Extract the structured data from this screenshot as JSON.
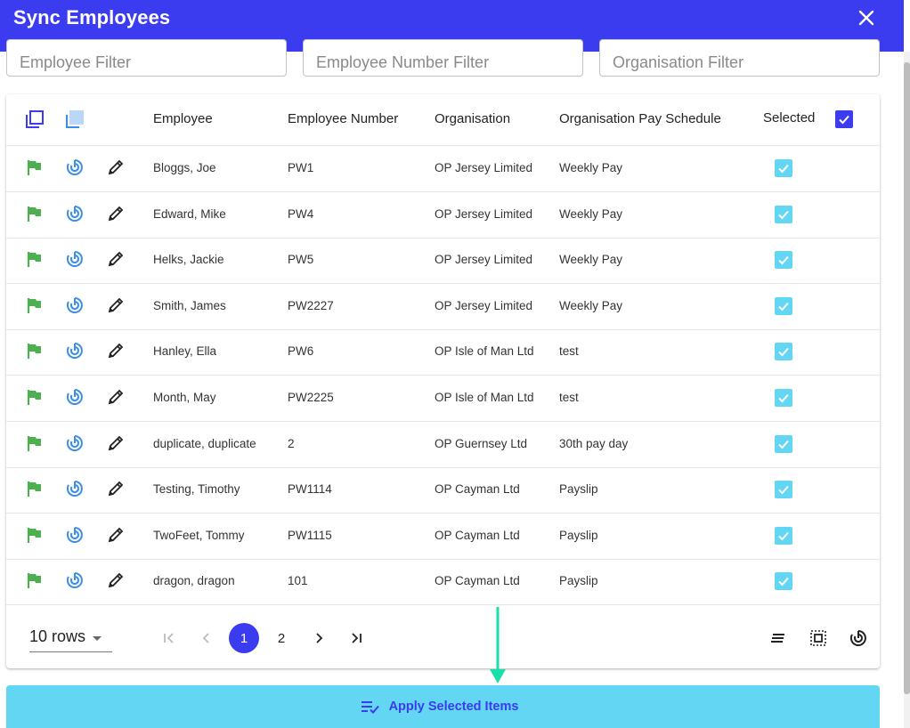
{
  "dialog": {
    "title": "Sync Employees",
    "close_icon": "close-icon"
  },
  "filters": {
    "employee_placeholder": "Employee Filter",
    "employee_number_placeholder": "Employee Number Filter",
    "organisation_placeholder": "Organisation Filter"
  },
  "table": {
    "headers": {
      "employee": "Employee",
      "employee_number": "Employee Number",
      "organisation": "Organisation",
      "pay_schedule": "Organisation Pay Schedule",
      "selected": "Selected"
    },
    "rows": [
      {
        "employee": "Bloggs, Joe",
        "number": "PW1",
        "organisation": "OP Jersey Limited",
        "schedule": "Weekly Pay",
        "selected": true
      },
      {
        "employee": "Edward, Mike",
        "number": "PW4",
        "organisation": "OP Jersey Limited",
        "schedule": "Weekly Pay",
        "selected": true
      },
      {
        "employee": "Helks, Jackie",
        "number": "PW5",
        "organisation": "OP Jersey Limited",
        "schedule": "Weekly Pay",
        "selected": true
      },
      {
        "employee": "Smith, James",
        "number": "PW2227",
        "organisation": "OP Jersey Limited",
        "schedule": "Weekly Pay",
        "selected": true
      },
      {
        "employee": "Hanley, Ella",
        "number": "PW6",
        "organisation": "OP Isle of Man Ltd",
        "schedule": "test",
        "selected": true
      },
      {
        "employee": "Month, May",
        "number": "PW2225",
        "organisation": "OP Isle of Man Ltd",
        "schedule": "test",
        "selected": true
      },
      {
        "employee": "duplicate, duplicate",
        "number": "2",
        "organisation": "OP Guernsey Ltd",
        "schedule": "30th pay day",
        "selected": true
      },
      {
        "employee": "Testing, Timothy",
        "number": "PW1114",
        "organisation": "OP Cayman Ltd",
        "schedule": "Payslip",
        "selected": true
      },
      {
        "employee": "TwoFeet, Tommy",
        "number": "PW1115",
        "organisation": "OP Cayman Ltd",
        "schedule": "Payslip",
        "selected": true
      },
      {
        "employee": "dragon, dragon",
        "number": "101",
        "organisation": "OP Cayman Ltd",
        "schedule": "Payslip",
        "selected": true
      }
    ]
  },
  "pagination": {
    "rows_per_page": "10 rows",
    "pages": [
      "1",
      "2"
    ],
    "current_page": "1"
  },
  "actions": {
    "apply_label": "Apply Selected Items"
  },
  "colors": {
    "primary": "#3b3bf0",
    "accent_cyan": "#62d6f2",
    "flag_green": "#4caf50",
    "sync_blue": "#3a8ee6",
    "arrow_teal": "#19e0a8"
  }
}
